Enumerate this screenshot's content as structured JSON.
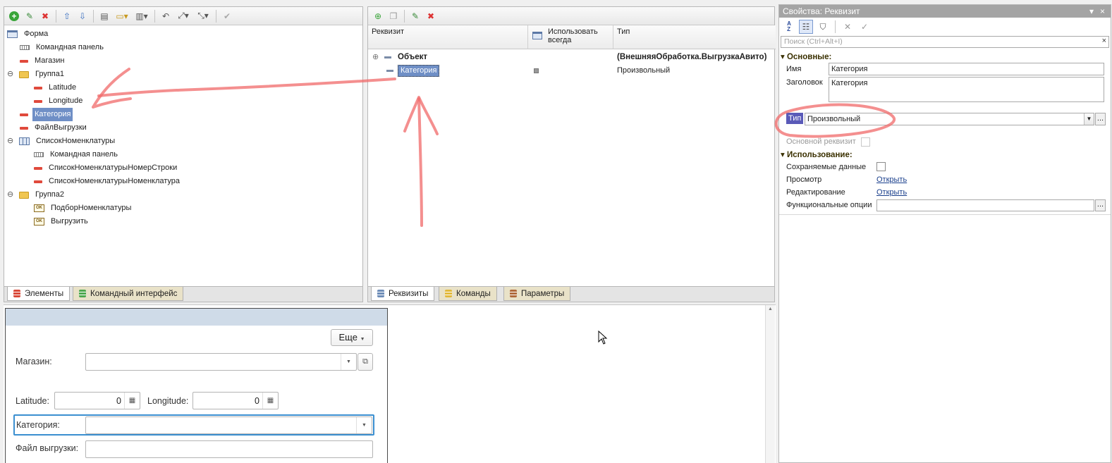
{
  "colors": {
    "selection": "#6f8fc6",
    "accent_red": "#e04a3c",
    "folder": "#f0c651",
    "annotation": "#f06a6a"
  },
  "elements_panel": {
    "tree": [
      {
        "label": "Форма",
        "icon": "form-icon"
      },
      {
        "label": "Командная панель",
        "icon": "command-bar-icon"
      },
      {
        "label": "Магазин",
        "icon": "field-icon"
      },
      {
        "label": "Группа1",
        "icon": "folder-icon",
        "expander": "⊖"
      },
      {
        "label": "Latitude",
        "icon": "field-icon"
      },
      {
        "label": "Longitude",
        "icon": "field-icon"
      },
      {
        "label": "Категория",
        "icon": "field-icon"
      },
      {
        "label": "ФайлВыгрузки",
        "icon": "field-icon"
      },
      {
        "label": "СписокНоменклатуры",
        "icon": "table-icon",
        "expander": "⊖"
      },
      {
        "label": "Командная панель",
        "icon": "command-bar-icon"
      },
      {
        "label": "СписокНоменклатурыНомерСтроки",
        "icon": "field-icon"
      },
      {
        "label": "СписокНоменклатурыНоменклатура",
        "icon": "field-icon"
      },
      {
        "label": "Группа2",
        "icon": "folder-icon",
        "expander": "⊖"
      },
      {
        "label": "ПодборНоменклатуры",
        "icon": "ok-button-icon"
      },
      {
        "label": "Выгрузить",
        "icon": "ok-button-icon"
      }
    ],
    "tabs": [
      "Элементы",
      "Командный интерфейс"
    ]
  },
  "attributes_panel": {
    "columns": [
      "Реквизит",
      "Использовать всегда",
      "Тип"
    ],
    "rows": [
      {
        "name": "Объект",
        "type": "(ВнешняяОбработка.ВыгрузкаАвито)",
        "expander": "⊕"
      },
      {
        "name": "Категория",
        "type": "Произвольный"
      }
    ],
    "tabs": [
      "Реквизиты",
      "Команды",
      "Параметры"
    ]
  },
  "properties": {
    "title": "Свойства: Реквизит",
    "window_controls": [
      "▾",
      "×"
    ],
    "search_placeholder": "Поиск (Ctrl+Alt+I)",
    "sections": {
      "main": "Основные:",
      "usage": "Использование:"
    },
    "name_label": "Имя",
    "name_value": "Категория",
    "caption_label": "Заголовок",
    "caption_value": "Категория",
    "type_label": "Тип",
    "type_value": "Произвольный",
    "main_attr_label": "Основной реквизит",
    "saved_data_label": "Сохраняемые данные",
    "view_label": "Просмотр",
    "view_link": "Открыть",
    "edit_label": "Редактирование",
    "edit_link": "Открыть",
    "func_options_label": "Функциональные опции",
    "ellipsis": "..."
  },
  "form_preview": {
    "more_button": "Еще",
    "shop_label": "Магазин:",
    "latitude_label": "Latitude:",
    "latitude_value": "0",
    "longitude_label": "Longitude:",
    "longitude_value": "0",
    "category_label": "Категория:",
    "file_label": "Файл выгрузки:"
  }
}
